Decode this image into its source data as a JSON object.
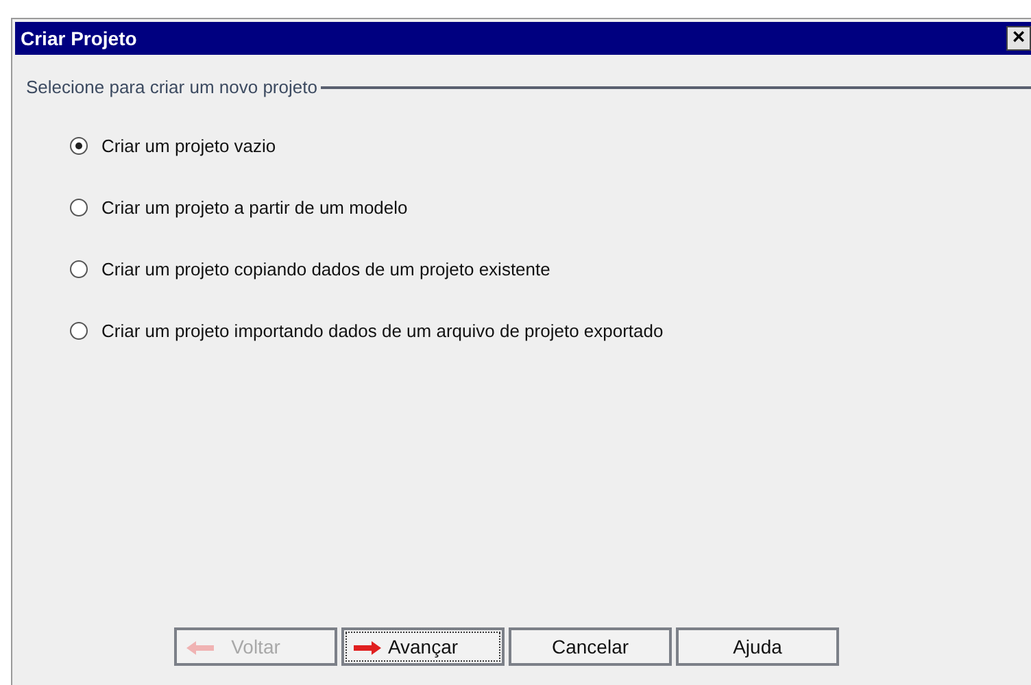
{
  "window": {
    "title": "Criar Projeto",
    "close": "×"
  },
  "section": {
    "title": "Selecione para criar um novo projeto"
  },
  "options": [
    {
      "label": "Criar um projeto vazio",
      "selected": true
    },
    {
      "label": "Criar um projeto a partir de um modelo",
      "selected": false
    },
    {
      "label": "Criar um projeto copiando dados de um projeto existente",
      "selected": false
    },
    {
      "label": "Criar um projeto importando dados de um arquivo de projeto exportado",
      "selected": false
    }
  ],
  "buttons": [
    {
      "label": "Voltar",
      "kind": "back",
      "disabled": true,
      "focused": false
    },
    {
      "label": "Avançar",
      "kind": "next",
      "disabled": false,
      "focused": true
    },
    {
      "label": "Cancelar",
      "kind": "plain",
      "disabled": false,
      "focused": false
    },
    {
      "label": "Ajuda",
      "kind": "plain",
      "disabled": false,
      "focused": false
    }
  ]
}
